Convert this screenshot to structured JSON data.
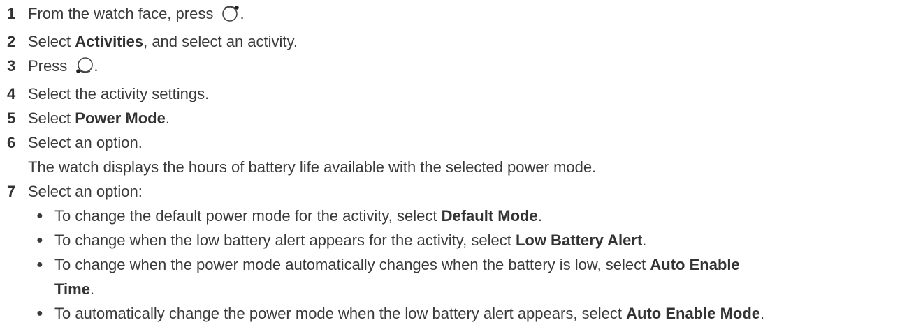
{
  "steps": [
    {
      "num": "1",
      "text": "From the watch face, press ",
      "icon": "watch-button-top-right-icon",
      "after": "."
    },
    {
      "num": "2",
      "pre": "Select ",
      "bold": "Activities",
      "post": ", and select an activity."
    },
    {
      "num": "3",
      "text": "Press ",
      "icon": "watch-button-bottom-left-icon",
      "after": "."
    },
    {
      "num": "4",
      "text": "Select the activity settings."
    },
    {
      "num": "5",
      "pre": "Select ",
      "bold": "Power Mode",
      "post": "."
    },
    {
      "num": "6",
      "text": "Select an option.",
      "continuation": "The watch displays the hours of battery life available with the selected power mode."
    },
    {
      "num": "7",
      "text": "Select an option:"
    }
  ],
  "bullets": [
    {
      "pre": "To change the default power mode for the activity, select ",
      "bold": "Default Mode",
      "post": "."
    },
    {
      "pre": "To change when the low battery alert appears for the activity, select ",
      "bold": "Low Battery Alert",
      "post": "."
    },
    {
      "pre": "To change when the power mode automatically changes when the battery is low, select ",
      "bold": "Auto Enable",
      "bold2": "Time",
      "post": "."
    },
    {
      "pre": "To automatically change the power mode when the low battery alert appears, select ",
      "bold": "Auto Enable Mode",
      "post": "."
    }
  ]
}
